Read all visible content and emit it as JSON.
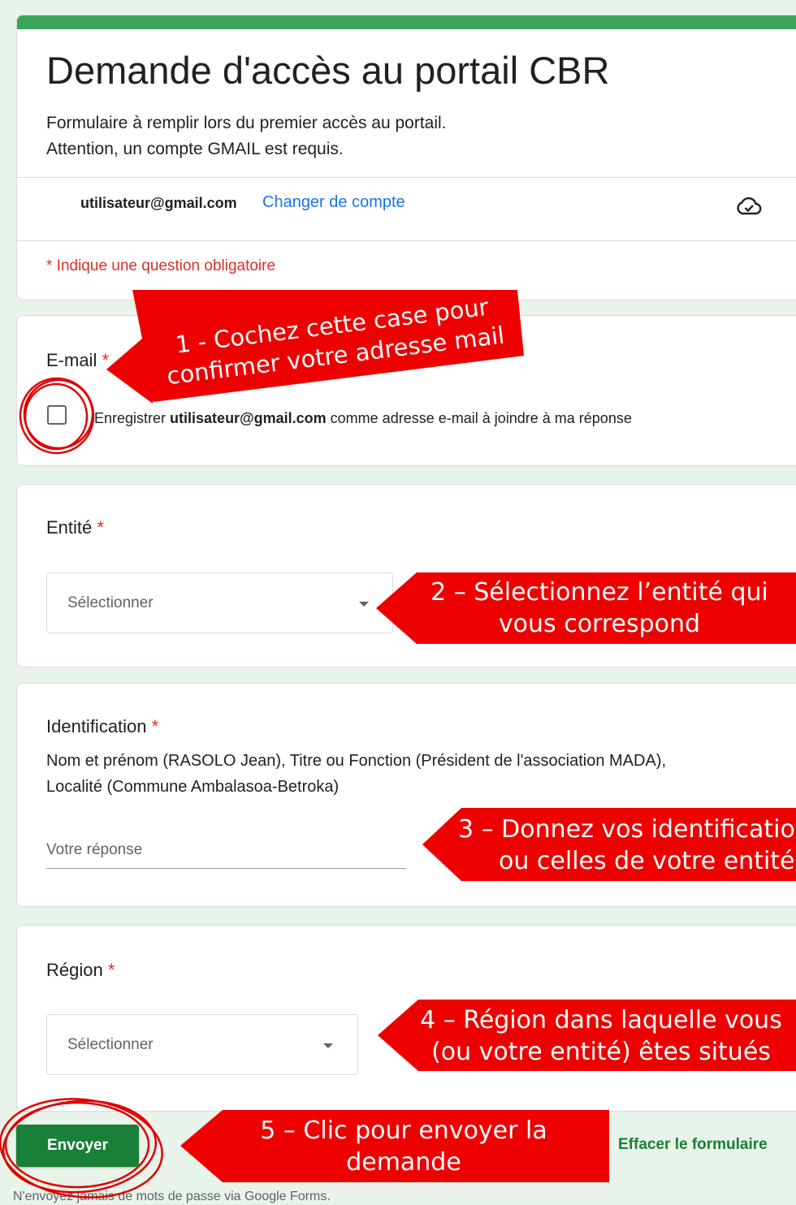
{
  "header": {
    "title": "Demande d'accès au portail CBR",
    "description_line1": "Formulaire à remplir lors du premier accès au portail.",
    "description_line2": "Attention, un compte GMAIL est requis.",
    "account_email": "utilisateur@gmail.com",
    "switch_account": "Changer de compte",
    "cloud_icon": "cloud-check-icon",
    "required_note": "* Indique une question obligatoire"
  },
  "email_question": {
    "title": "E-mail",
    "required_mark": "*",
    "checkbox_prefix": "Enregistrer",
    "checkbox_email": "utilisateur@gmail.com",
    "checkbox_suffix": "comme adresse e-mail à joindre à ma réponse"
  },
  "entity_question": {
    "title": "Entité",
    "required_mark": "*",
    "select_placeholder": "Sélectionner"
  },
  "identification_question": {
    "title": "Identification",
    "required_mark": "*",
    "description_line1": "Nom et prénom (RASOLO Jean), Titre ou Fonction (Président de l'association MADA),",
    "description_line2": "Localité (Commune Ambalasoa-Betroka)",
    "answer_placeholder": "Votre réponse"
  },
  "region_question": {
    "title": "Région",
    "required_mark": "*",
    "select_placeholder": "Sélectionner"
  },
  "footer": {
    "submit_label": "Envoyer",
    "clear_label": "Effacer le formulaire",
    "warning": "N'envoyez jamais de mots de passe via Google Forms."
  },
  "annotations": {
    "step1_line1": "1 - Cochez cette case pour",
    "step1_line2": "confirmer votre adresse mail",
    "step2_line1": "2 – Sélectionnez l’entité qui",
    "step2_line2": "vous correspond",
    "step3_line1": "3 – Donnez vos identificatio",
    "step3_line2": "ou celles de votre entité",
    "step4_line1": "4 – Région dans laquelle vous",
    "step4_line2": "(ou votre entité) êtes situés",
    "step5_line1": "5 – Clic pour envoyer la",
    "step5_line2": "demande"
  },
  "colors": {
    "page_bg": "#e8f3e9",
    "header_accent": "#3ba55c",
    "submit_green": "#188038",
    "required_red": "#d93025",
    "link_blue": "#1a73e8",
    "annotation_red": "#ee0000"
  }
}
